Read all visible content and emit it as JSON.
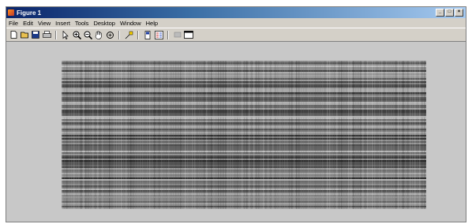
{
  "window": {
    "title": "Figure 1",
    "controls": [
      "_",
      "□",
      "×"
    ]
  },
  "menu": {
    "items": [
      "File",
      "Edit",
      "View",
      "Insert",
      "Tools",
      "Desktop",
      "Window",
      "Help"
    ]
  },
  "toolbar": {
    "icons": [
      "new-icon",
      "open-icon",
      "save-icon",
      "print-icon",
      "pointer-icon",
      "zoom-in-icon",
      "zoom-out-icon",
      "pan-icon",
      "rotate-icon",
      "data-cursor-icon",
      "colorbar-icon",
      "legend-icon",
      "hide-plot-tools-icon",
      "show-plot-tools-icon"
    ]
  },
  "figure": {
    "colormap": "gray"
  }
}
